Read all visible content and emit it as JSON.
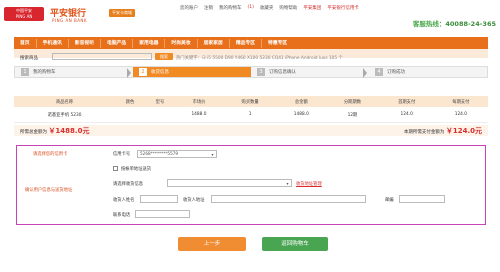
{
  "header": {
    "logo_small_cn": "中国平安",
    "logo_small_en": "PING AN",
    "bank_name": "平安银行",
    "bank_name_en": "PING AN BANK",
    "badge": "平安卡商城",
    "links": [
      "您的账户",
      "注销",
      "我的购物车",
      "(1)",
      "收藏夹",
      "购物帮助",
      "平安集团",
      "平安银行信用卡"
    ],
    "hotline_label": "客服热线：",
    "hotline_number": "40088-24-365"
  },
  "nav": {
    "items": [
      "首页",
      "手机通讯",
      "影音视听",
      "电脑产品",
      "家用电器",
      "时尚美妆",
      "居家家居",
      "精品专区",
      "特惠专区"
    ]
  },
  "search": {
    "label": "搜索商品",
    "button": "搜索",
    "hot_label": "热门关键字：",
    "hot_keywords": "i3 i5 5500 D90 Y460 X100 5230 CQ41 iPhone Android luxs 105 个"
  },
  "steps": [
    {
      "num": "1",
      "label": "我的购物车"
    },
    {
      "num": "2",
      "label": "收货信息"
    },
    {
      "num": "3",
      "label": "订购信息确认"
    },
    {
      "num": "4",
      "label": "订购成功"
    }
  ],
  "table": {
    "headers": [
      "商品名称",
      "颜色",
      "型号",
      "市场价",
      "购买数量",
      "总金额",
      "分期期数",
      "首期支付",
      "每期支付"
    ],
    "rows": [
      [
        "诺基亚手机 5230",
        "",
        "",
        "1488.0",
        "1",
        "1488.0",
        "12期",
        "124.0",
        "124.0"
      ]
    ]
  },
  "summary": {
    "total_label": "所需总金额为",
    "total_amount": "￥1488.0元",
    "first_label": "本期所需支付金额为",
    "first_amount": "￥124.0元"
  },
  "form": {
    "card_section_label": "请选择您的信用卡",
    "address_section_label": "确认用户信息与送货地址",
    "card_label": "信用卡号",
    "card_value": "5268********5579",
    "same_as_bill": "按帐单地址送货",
    "address_select_label": "请选择收货信息",
    "manage_link": "收货地址管理",
    "receiver_name": "收货人姓名",
    "receiver_address": "收货人地址",
    "postcode": "邮编",
    "phone": "联系电话"
  },
  "buttons": {
    "prev": "上一步",
    "back": "返回购物车"
  },
  "colors": {
    "accent_orange": "#e9701b",
    "highlight_pink": "#c545b8",
    "price_red": "#d72d2d",
    "green": "#4aa552"
  }
}
